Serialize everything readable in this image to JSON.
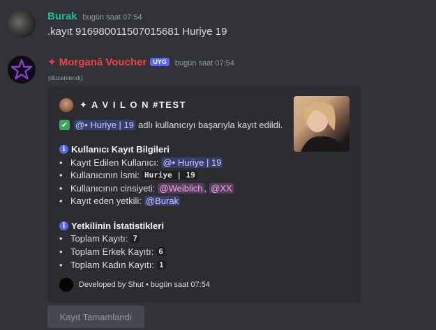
{
  "messages": [
    {
      "author": "Burak",
      "author_color": "#1abc9c",
      "timestamp": "bugün saat 07:54",
      "content": ".kayıt 916980011507015681 Huriye 19"
    },
    {
      "author": "✦ Morganâ Voucher",
      "author_color": "#ed4245",
      "app_badge": "UYG",
      "timestamp": "bugün saat 07:54",
      "edited": "(düzenlendi)"
    }
  ],
  "embed": {
    "author": "✦ A V I L O N #TEST",
    "success_mention": "@• Huriye | 19",
    "success_text": "adlı kullanıcıyı başarıyla kayıt edildi.",
    "section1_title": "Kullanıcı Kayıt Bilgileri",
    "s1_item1_label": "Kayıt Edilen Kullanıcı:",
    "s1_item1_value": "@• Huriye | 19",
    "s1_item2_label": "Kullanıcının İsmi:",
    "s1_item2_value": "Huriye | 19",
    "s1_item3_label": "Kullanıcının cinsiyeti:",
    "s1_item3_role1": "@Weiblich",
    "s1_item3_sep": ",",
    "s1_item3_role2": "@XX",
    "s1_item4_label": "Kayıt eden yetkili:",
    "s1_item4_value": "@Burak",
    "section2_title": "Yetkilinin İstatistikleri",
    "s2_item1_label": "Toplam Kayıtı:",
    "s2_item1_value": "7",
    "s2_item2_label": "Toplam Erkek Kayıtı:",
    "s2_item2_value": "6",
    "s2_item3_label": "Toplam Kadın Kayıtı:",
    "s2_item3_value": "1",
    "bullet": "•",
    "check_glyph": "✔",
    "info_glyph": "i",
    "footer": "Developed by Shut • bugün saat 07:54"
  },
  "button": {
    "label": "Kayıt Tamamlandı",
    "disabled": true
  },
  "icons": {
    "bot_avatar": "purple-star-icon",
    "success": "check-icon",
    "info": "info-icon"
  },
  "colors": {
    "background": "#313338",
    "embed": "#2b2d31",
    "accent": "#5865f2",
    "bot_avatar_star": "#8a3fd1"
  }
}
